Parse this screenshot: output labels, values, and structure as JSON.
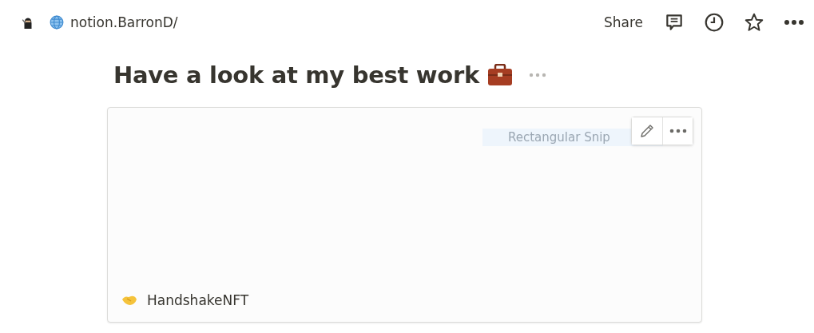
{
  "topbar": {
    "breadcrumb": "notion.BarronD/",
    "share": "Share"
  },
  "page": {
    "title": "Have a look at my best work"
  },
  "card": {
    "overlay_label": "Rectangular Snip",
    "title": "HandshakeNFT"
  }
}
